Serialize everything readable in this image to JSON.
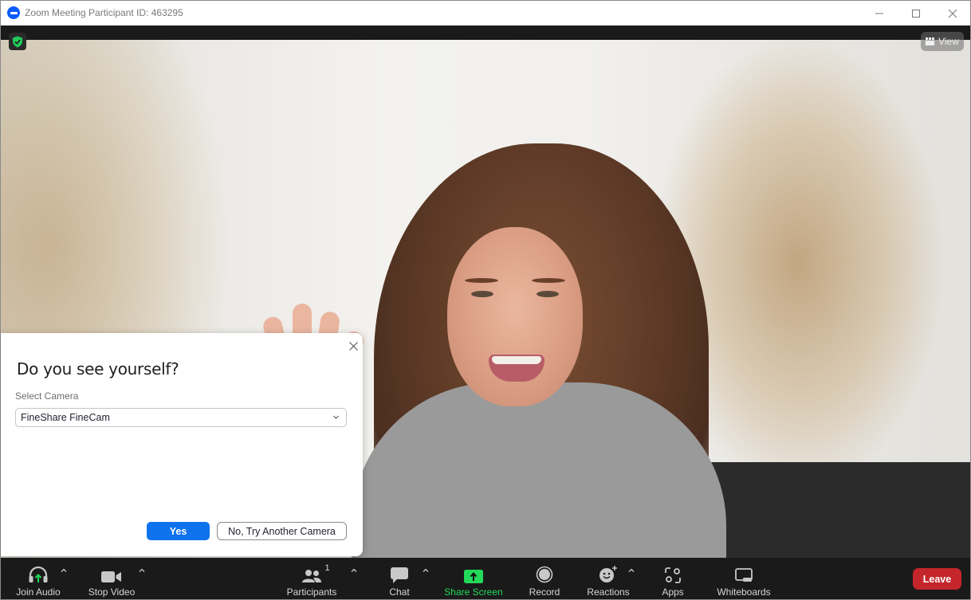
{
  "window": {
    "title": "Zoom Meeting Participant ID: 463295",
    "controls": {
      "minimize": "minimize",
      "maximize": "maximize",
      "close": "close"
    }
  },
  "video": {
    "view_button_label": "View",
    "security_badge": "verified-shield"
  },
  "dialog": {
    "title": "Do you see yourself?",
    "select_label": "Select Camera",
    "selected_camera": "FineShare FineCam",
    "yes_label": "Yes",
    "no_label": "No, Try Another Camera"
  },
  "toolbar": {
    "items": [
      {
        "id": "join-audio",
        "label": "Join Audio",
        "icon": "headphones-icon",
        "has_caret": true
      },
      {
        "id": "stop-video",
        "label": "Stop Video",
        "icon": "video-camera-icon",
        "has_caret": true
      },
      {
        "id": "participants",
        "label": "Participants",
        "icon": "people-icon",
        "count": "1",
        "has_caret": true
      },
      {
        "id": "chat",
        "label": "Chat",
        "icon": "chat-bubble-icon",
        "has_caret": true
      },
      {
        "id": "share-screen",
        "label": "Share Screen",
        "icon": "share-screen-icon",
        "has_caret": false
      },
      {
        "id": "record",
        "label": "Record",
        "icon": "record-icon",
        "has_caret": false
      },
      {
        "id": "reactions",
        "label": "Reactions",
        "icon": "smiley-plus-icon",
        "has_caret": true
      },
      {
        "id": "apps",
        "label": "Apps",
        "icon": "apps-icon",
        "has_caret": false
      },
      {
        "id": "whiteboards",
        "label": "Whiteboards",
        "icon": "whiteboard-icon",
        "has_caret": false
      }
    ],
    "leave_label": "Leave"
  },
  "colors": {
    "accent_blue": "#0e72ed",
    "share_green": "#23d959",
    "leave_red": "#c4262b",
    "toolbar_bg": "#1a1a1a"
  }
}
